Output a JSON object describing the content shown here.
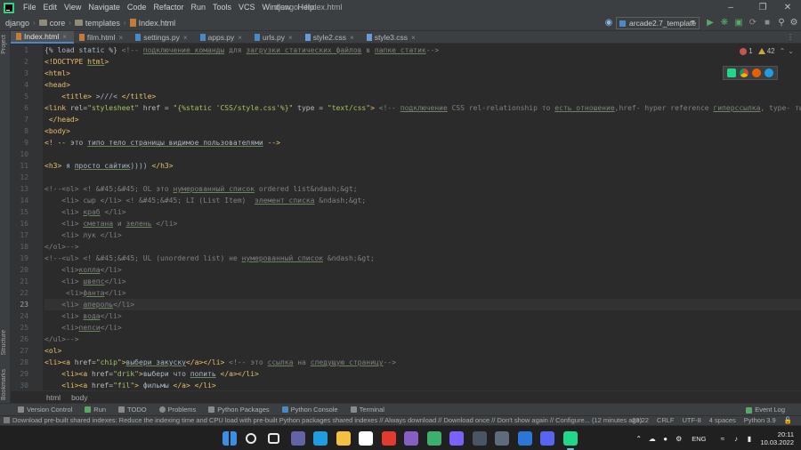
{
  "window": {
    "title": "django - Index.html",
    "menu": [
      "File",
      "Edit",
      "View",
      "Navigate",
      "Code",
      "Refactor",
      "Run",
      "Tools",
      "VCS",
      "Window",
      "Help"
    ]
  },
  "nav": {
    "crumbs": [
      "django",
      "core",
      "templates",
      "Index.html"
    ],
    "run_config": "arcade2.7_template"
  },
  "left_strip": {
    "project": "Project",
    "structure": "Structure",
    "bookmarks": "Bookmarks"
  },
  "tabs": [
    {
      "label": "Index.html",
      "color": "#c47a39"
    },
    {
      "label": "film.html",
      "color": "#c47a39"
    },
    {
      "label": "settings.py",
      "color": "#4a88c7"
    },
    {
      "label": "apps.py",
      "color": "#4a88c7"
    },
    {
      "label": "urls.py",
      "color": "#4a88c7"
    },
    {
      "label": "style2.css",
      "color": "#6a9ad6"
    },
    {
      "label": "style3.css",
      "color": "#6a9ad6"
    }
  ],
  "inspections": {
    "errors": "1",
    "warnings": "42"
  },
  "editor": {
    "current_line": 23,
    "lines": [
      [
        [
          "t-tpl",
          "{% load static %} "
        ],
        [
          "t-cm",
          "<!-- "
        ],
        [
          "t-cm u",
          "подключение команды"
        ],
        [
          "t-cm",
          " для "
        ],
        [
          "t-cm u",
          "загрузки статических файлов"
        ],
        [
          "t-cm",
          " в "
        ],
        [
          "t-cm u",
          "папке статик"
        ],
        [
          "t-cm",
          "-->"
        ]
      ],
      [
        [
          "t-doc",
          "<!DOCTYPE "
        ],
        [
          "t-doc u",
          "html"
        ],
        [
          "t-doc",
          ">"
        ]
      ],
      [
        [
          "t-tag",
          "<html>"
        ]
      ],
      [
        [
          "t-tag",
          "<head>"
        ]
      ],
      [
        [
          "t-txt",
          "    "
        ],
        [
          "t-tag",
          "<title>"
        ],
        [
          "t-txt",
          " >///< "
        ],
        [
          "t-tag",
          "</title>"
        ]
      ],
      [
        [
          "t-tag",
          "<link "
        ],
        [
          "t-attr",
          "rel="
        ],
        [
          "t-val",
          "\"stylesheet\""
        ],
        [
          "t-attr",
          " href = "
        ],
        [
          "t-val",
          "\"{%static 'CSS/style.css'%}\""
        ],
        [
          "t-attr",
          " type = "
        ],
        [
          "t-val",
          "\"text/css\""
        ],
        [
          "t-tag",
          ">"
        ],
        [
          "t-cm",
          " <!-- "
        ],
        [
          "t-cm u",
          "подключение"
        ],
        [
          "t-cm",
          " CSS rel-relationship то "
        ],
        [
          "t-cm u",
          "есть отношение"
        ],
        [
          "t-cm",
          ",href- hyper reference "
        ],
        [
          "t-cm u",
          "гиперссылка"
        ],
        [
          "t-cm",
          ", type- тип"
        ]
      ],
      [
        [
          "t-txt",
          " "
        ],
        [
          "t-tag",
          "</head>"
        ]
      ],
      [
        [
          "t-tag",
          "<body>"
        ]
      ],
      [
        [
          "t-tag",
          "<! -- "
        ],
        [
          "t-txt",
          "это "
        ],
        [
          "t-txt u",
          "типо тело страницы видимое пользователями"
        ],
        [
          "t-tag",
          " -->"
        ]
      ],
      [],
      [
        [
          "t-tag",
          "<h3>"
        ],
        [
          "t-txt",
          " я "
        ],
        [
          "t-txt u",
          "просто сайтик"
        ],
        [
          "t-txt",
          ")))) "
        ],
        [
          "t-tag",
          "</h3>"
        ]
      ],
      [],
      [
        [
          "t-cm",
          "<!--<ol> <! &#45;&#45; OL это "
        ],
        [
          "t-cm u",
          "нумерованный список"
        ],
        [
          "t-cm",
          " ordered list&ndash;&gt;"
        ]
      ],
      [
        [
          "t-cm",
          "    <li> сыр </li> <! &#45;&#45; LI (List Item)  "
        ],
        [
          "t-cm u",
          "элемент списка"
        ],
        [
          "t-cm",
          " &ndash;&gt;"
        ]
      ],
      [
        [
          "t-cm",
          "    <li> "
        ],
        [
          "t-cm u",
          "краб"
        ],
        [
          "t-cm",
          " </li>"
        ]
      ],
      [
        [
          "t-cm",
          "    <li> "
        ],
        [
          "t-cm u",
          "сметана"
        ],
        [
          "t-cm",
          " и "
        ],
        [
          "t-cm u",
          "зелень"
        ],
        [
          "t-cm",
          " </li>"
        ]
      ],
      [
        [
          "t-cm",
          "    <li> лук </li>"
        ]
      ],
      [
        [
          "t-cm",
          "</ol>-->"
        ]
      ],
      [
        [
          "t-cm",
          "<!--<ul> <! &#45;&#45; UL (unordered list) не "
        ],
        [
          "t-cm u",
          "нумерованный список"
        ],
        [
          "t-cm",
          " &ndash;&gt;"
        ]
      ],
      [
        [
          "t-cm",
          "    <li>"
        ],
        [
          "t-cm u",
          "колла"
        ],
        [
          "t-cm",
          "</li>"
        ]
      ],
      [
        [
          "t-cm",
          "    <li> "
        ],
        [
          "t-cm u",
          "швепс"
        ],
        [
          "t-cm",
          "</li>"
        ]
      ],
      [
        [
          "t-cm",
          "     <li>"
        ],
        [
          "t-cm u",
          "фанта"
        ],
        [
          "t-cm",
          "</li>"
        ]
      ],
      [
        [
          "t-cm",
          "    <li> "
        ],
        [
          "t-cm u",
          "апероль"
        ],
        [
          "t-cm",
          "</li>"
        ]
      ],
      [
        [
          "t-cm",
          "    <li> "
        ],
        [
          "t-cm u",
          "вода"
        ],
        [
          "t-cm",
          "</li>"
        ]
      ],
      [
        [
          "t-cm",
          "    <li>"
        ],
        [
          "t-cm u",
          "пепси"
        ],
        [
          "t-cm",
          "</li>"
        ]
      ],
      [
        [
          "t-cm",
          "</ul>-->"
        ]
      ],
      [
        [
          "t-tag",
          "<ol>"
        ]
      ],
      [
        [
          "t-tag",
          "<li><a "
        ],
        [
          "t-attr",
          "href="
        ],
        [
          "t-val",
          "\"chip\""
        ],
        [
          "t-tag",
          ">"
        ],
        [
          "t-txt u",
          "выбери закуску"
        ],
        [
          "t-tag",
          "</a></li>"
        ],
        [
          "t-cm",
          " <!-- это "
        ],
        [
          "t-cm u",
          "ссылка"
        ],
        [
          "t-cm",
          " на "
        ],
        [
          "t-cm u",
          "следущую страницу"
        ],
        [
          "t-cm",
          "-->"
        ]
      ],
      [
        [
          "t-txt",
          "    "
        ],
        [
          "t-tag",
          "<li><a "
        ],
        [
          "t-attr",
          "href="
        ],
        [
          "t-val",
          "\"drik\""
        ],
        [
          "t-tag",
          ">"
        ],
        [
          "t-txt",
          "выбери что "
        ],
        [
          "t-txt u",
          "попить"
        ],
        [
          "t-tag",
          " </a></li>"
        ]
      ],
      [
        [
          "t-txt",
          "    "
        ],
        [
          "t-tag",
          "<li><a "
        ],
        [
          "t-attr",
          "href="
        ],
        [
          "t-val",
          "\"fil\""
        ],
        [
          "t-tag",
          ">"
        ],
        [
          "t-txt",
          " фильмы "
        ],
        [
          "t-tag",
          "</a> </li>"
        ]
      ]
    ]
  },
  "breadcrumb_bottom": [
    "html",
    "body"
  ],
  "tool_windows": [
    "Version Control",
    "Run",
    "TODO",
    "Problems",
    "Python Packages",
    "Python Console",
    "Terminal"
  ],
  "event_log": "Event Log",
  "status": {
    "message": "Download pre-built shared indexes: Reduce the indexing time and CPU load with pre-built Python packages shared indexes // Always download // Download once // Don't show again // Configure... (12 minutes ago)",
    "position": "23:22",
    "line_sep": "CRLF",
    "encoding": "UTF-8",
    "indent": "4 spaces",
    "interpreter": "Python 3.9"
  },
  "taskbar": {
    "lang": "ENG",
    "time": "20:11",
    "date": "10.03.2022",
    "apps": [
      {
        "name": "windows-start-icon",
        "color": "#3a8ee6"
      },
      {
        "name": "search-icon",
        "color": "#202020"
      },
      {
        "name": "task-view-icon",
        "color": "#202020"
      },
      {
        "name": "chat-icon",
        "color": "#6264a7"
      },
      {
        "name": "edge-icon",
        "color": "#1e9de0"
      },
      {
        "name": "explorer-icon",
        "color": "#f2c043"
      },
      {
        "name": "yandex-icon",
        "color": "#ffffff"
      },
      {
        "name": "yandex-browser-icon",
        "color": "#e23b2e"
      },
      {
        "name": "visual-studio-icon",
        "color": "#865fc5"
      },
      {
        "name": "app-green-icon",
        "color": "#3db06f"
      },
      {
        "name": "app-violet-icon",
        "color": "#7b61ff"
      },
      {
        "name": "app-monitor-icon",
        "color": "#4a5563"
      },
      {
        "name": "app-photo-icon",
        "color": "#5d6b7a"
      },
      {
        "name": "app-blue-icon",
        "color": "#2b77d8"
      },
      {
        "name": "discord-icon",
        "color": "#5865f2"
      },
      {
        "name": "pycharm-icon",
        "color": "#21d789"
      }
    ]
  }
}
